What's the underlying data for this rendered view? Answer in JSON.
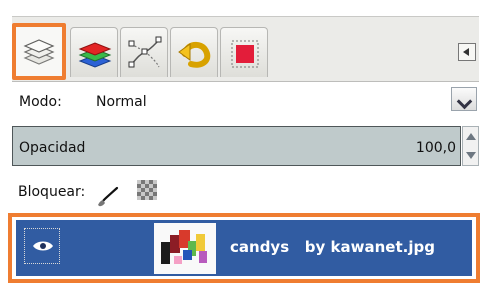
{
  "tabs": [
    {
      "icon": "layers-icon",
      "active": true
    },
    {
      "icon": "channels-icon",
      "active": false
    },
    {
      "icon": "paths-icon",
      "active": false
    },
    {
      "icon": "undo-history-icon",
      "active": false
    },
    {
      "icon": "image-preview-icon",
      "active": false
    }
  ],
  "tab_menu": {
    "icon": "tab-menu-icon"
  },
  "mode": {
    "label": "Modo:",
    "value": "Normal"
  },
  "opacity": {
    "label": "Opacidad",
    "value": "100,0"
  },
  "lock": {
    "label": "Bloquear:"
  },
  "layer": {
    "name": "candys   by kawanet.jpg",
    "visibility_icon": "eye-icon",
    "thumbnail": "candy-thumbnail"
  },
  "colors": {
    "accent": "#ef7d31",
    "selected_row": "#315ca2",
    "opacity_bar": "#bfcacb"
  }
}
